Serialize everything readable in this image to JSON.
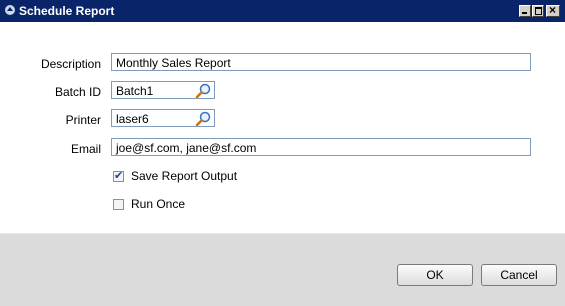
{
  "window": {
    "title": "Schedule Report"
  },
  "form": {
    "description": {
      "label": "Description",
      "value": "Monthly Sales Report"
    },
    "batch_id": {
      "label": "Batch ID",
      "value": "Batch1"
    },
    "printer": {
      "label": "Printer",
      "value": "laser6"
    },
    "email": {
      "label": "Email",
      "value": "joe@sf.com, jane@sf.com"
    }
  },
  "options": {
    "save_report_output": {
      "label": "Save Report Output",
      "checked": true
    },
    "run_once": {
      "label": "Run Once",
      "checked": false
    }
  },
  "buttons": {
    "ok": "OK",
    "cancel": "Cancel"
  },
  "icons": {
    "title": "window-icon",
    "lookup": "search-icon"
  }
}
